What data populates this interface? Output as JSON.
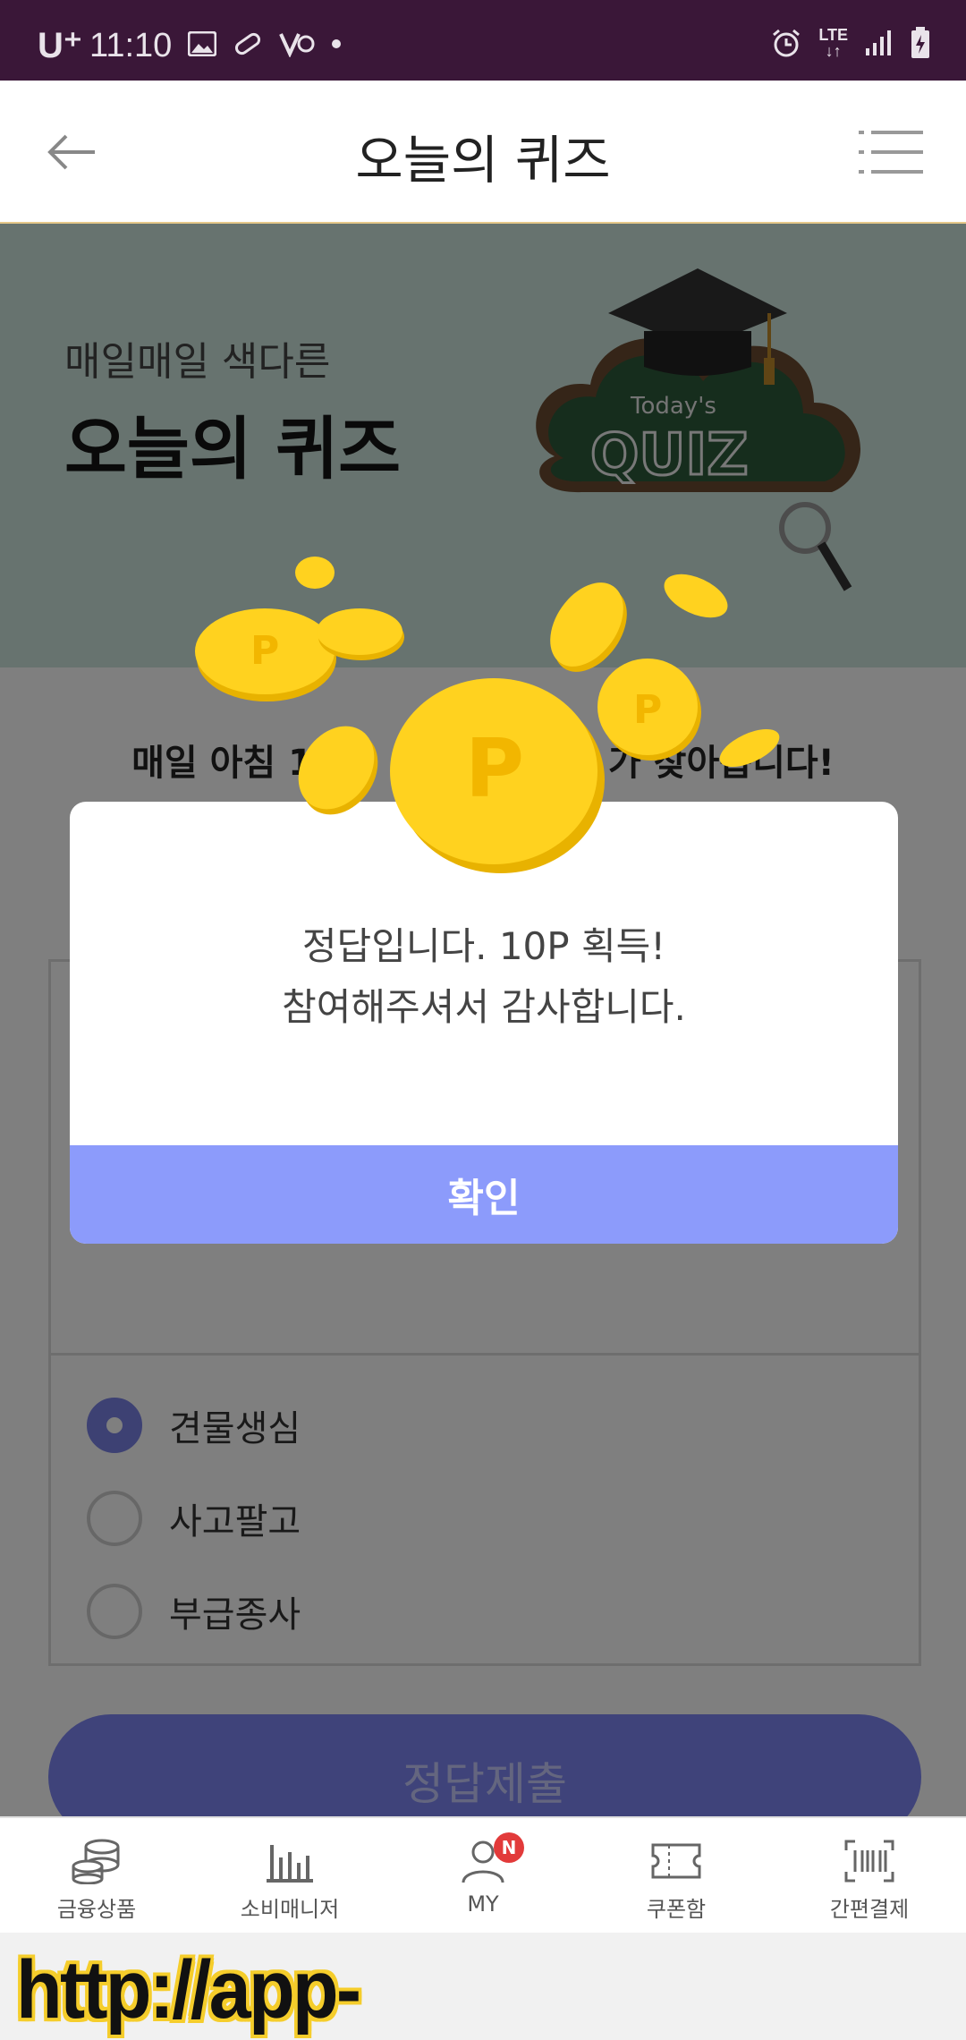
{
  "status_bar": {
    "carrier": "U⁺",
    "time": "11:10",
    "network": "LTE"
  },
  "header": {
    "title": "오늘의 퀴즈"
  },
  "banner": {
    "subtitle": "매일매일 색다른",
    "title": "오늘의 퀴즈",
    "art_small": "Today's",
    "art_big": "QUIZ"
  },
  "notice_text": "매일 아침 1",
  "notice_tail": "가 찾아옵니다!",
  "quiz": {
    "options": [
      {
        "label": "견물생심",
        "selected": true
      },
      {
        "label": "사고팔고",
        "selected": false
      },
      {
        "label": "부급종사",
        "selected": false
      }
    ],
    "submit_label": "정답제출"
  },
  "dialog": {
    "line1": "정답입니다. 10P 획득!",
    "line2": "참여해주셔서 감사합니다.",
    "ok_label": "확인"
  },
  "bottom_nav": {
    "items": [
      {
        "label": "금융상품",
        "icon": "coins-stack-icon"
      },
      {
        "label": "소비매니저",
        "icon": "bar-chart-icon"
      },
      {
        "label": "MY",
        "icon": "user-icon",
        "badge": "N"
      },
      {
        "label": "쿠폰함",
        "icon": "ticket-icon"
      },
      {
        "label": "간편결제",
        "icon": "barcode-icon"
      }
    ]
  },
  "watermark": "http://app-tech.tistory.com",
  "colors": {
    "status_bar": "#3a1738",
    "accent": "#8c9bfb",
    "coin": "#ffd21f",
    "badge": "#e23a3a"
  }
}
